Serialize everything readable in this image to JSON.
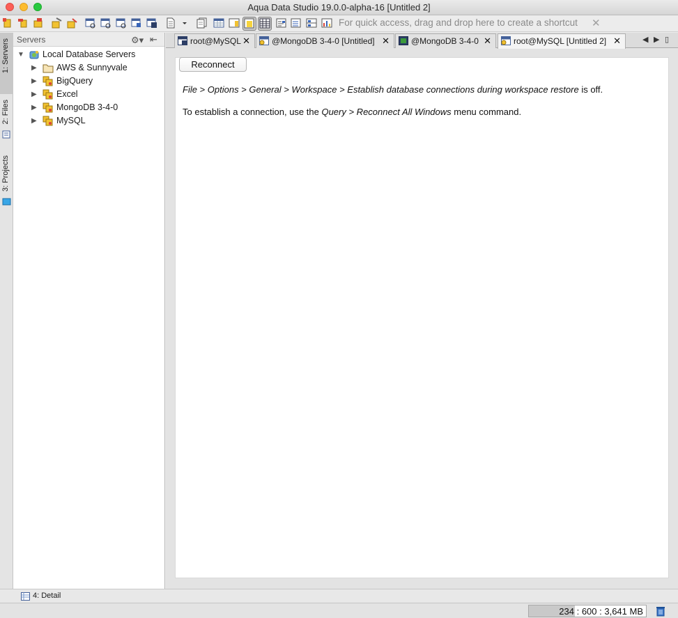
{
  "window": {
    "title": "Aqua Data Studio 19.0.0-alpha-16 [Untitled 2]"
  },
  "toolbar": {
    "shortcut_hint": "For quick access, drag and drop here to create a shortcut",
    "shortcut_close": "✕"
  },
  "side_tabs": [
    {
      "label": "1: Servers"
    },
    {
      "label": "2: Files"
    },
    {
      "label": "3: Projects"
    }
  ],
  "servers_panel": {
    "title": "Servers",
    "gear": "⚙▾",
    "collapse": "⇤",
    "root": "Local Database Servers",
    "items": [
      {
        "label": "AWS & Sunnyvale",
        "icon": "folder-icon"
      },
      {
        "label": "BigQuery",
        "icon": "server-group-icon"
      },
      {
        "label": "Excel",
        "icon": "server-group-icon"
      },
      {
        "label": "MongoDB 3-4-0",
        "icon": "server-group-icon"
      },
      {
        "label": "MySQL",
        "icon": "server-group-icon"
      }
    ]
  },
  "tabs": [
    {
      "label": "root@MySQL",
      "close": "✕"
    },
    {
      "label": "@MongoDB 3-4-0 [Untitled]",
      "close": "✕"
    },
    {
      "label": "@MongoDB 3-4-0",
      "close": "✕"
    },
    {
      "label": "root@MySQL [Untitled 2]",
      "close": "✕"
    }
  ],
  "tab_nav": {
    "left": "◀",
    "right": "▶",
    "menu": "▯"
  },
  "content": {
    "reconnect_label": "Reconnect",
    "line1_path": "File > Options > General > Workspace > Establish database connections during workspace restore",
    "line1_suffix": " is off.",
    "line2_prefix": "To establish a connection, use the ",
    "line2_path": "Query > Reconnect All Windows",
    "line2_suffix": " menu command."
  },
  "detail": {
    "label": "4: Detail"
  },
  "status": {
    "memory": "234 : 600 : 3,641 MB",
    "memory_fraction": 0.39
  }
}
